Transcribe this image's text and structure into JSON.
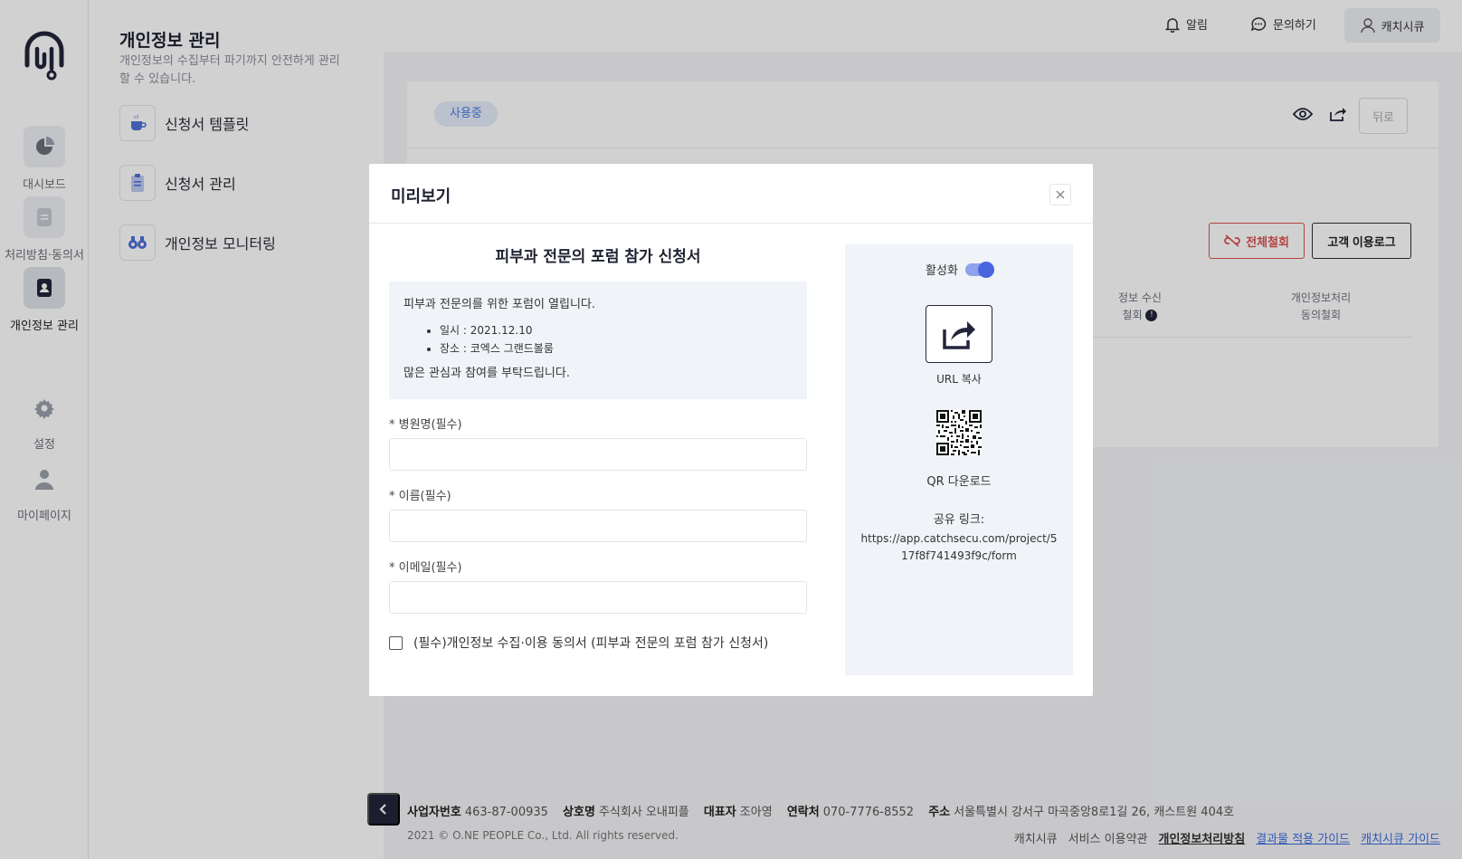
{
  "rail": {
    "items": [
      {
        "label": "대시보드"
      },
      {
        "label": "처리방침·동의서"
      },
      {
        "label": "개인정보 관리"
      },
      {
        "label": "설정"
      },
      {
        "label": "마이페이지"
      }
    ]
  },
  "subnav": {
    "title": "개인정보 관리",
    "description": "개인정보의 수집부터 파기까지 안전하게 관리할 수 있습니다.",
    "items": [
      {
        "label": "신청서 템플릿"
      },
      {
        "label": "신청서 관리"
      },
      {
        "label": "개인정보 모니터링"
      }
    ]
  },
  "topbar": {
    "notifications": "알림",
    "inquiry": "문의하기",
    "user": "캐치시큐"
  },
  "card": {
    "status": "사용중",
    "back": "뒤로",
    "revoke_all": "전체철회",
    "customer_log": "고객 이용로그",
    "col_consent_line1": "정보 수신",
    "col_consent_line2": "철회",
    "col_privacy_line1": "개인정보처리",
    "col_privacy_line2": "동의철회"
  },
  "footer": {
    "biz_no_label": "사업자번호",
    "biz_no": "463-87-00935",
    "company_label": "상호명",
    "company": "주식회사 오내피플",
    "ceo_label": "대표자",
    "ceo": "조아영",
    "phone_label": "연락처",
    "phone": "070-7776-8552",
    "address_label": "주소",
    "address": "서울특별시 강서구 마곡중앙8로1길 26, 캐스트원 404호",
    "copyright": "2021 © O.NE PEOPLE Co., Ltd. All rights reserved.",
    "links": {
      "catchsecu": "캐치시큐",
      "terms": "서비스 이용약관",
      "privacy": "개인정보처리방침",
      "result_guide": "결과물 적용 가이드",
      "guide": "캐치시큐 가이드"
    }
  },
  "modal": {
    "title": "미리보기",
    "form_title": "피부과 전문의 포럼 참가 신청서",
    "intro": "피부과 전문의를 위한 포럼이 열립니다.",
    "bullets": [
      "일시 : 2021.12.10",
      "장소 : 코엑스 그랜드볼룸"
    ],
    "closing": "많은 관심과 참여를 부탁드립니다.",
    "fields": [
      {
        "label": "* 병원명(필수)",
        "value": ""
      },
      {
        "label": "* 이름(필수)",
        "value": ""
      },
      {
        "label": "* 이메일(필수)",
        "value": ""
      }
    ],
    "consent": "(필수)개인정보 수집·이용 동의서 (피부과 전문의 포럼 참가 신청서)",
    "consent_checked": false,
    "share": {
      "activate_label": "활성화",
      "active": true,
      "url_copy": "URL 복사",
      "qr_download": "QR 다운로드",
      "link_label": "공유 링크:",
      "link": "https://app.catchsecu.com/project/517f8f741493f9c/form"
    }
  },
  "colors": {
    "accent": "#4966e0",
    "dark": "#23253a",
    "danger": "#d9534f",
    "pill_bg": "#e4ecfb",
    "pill_text": "#4a7be0"
  }
}
